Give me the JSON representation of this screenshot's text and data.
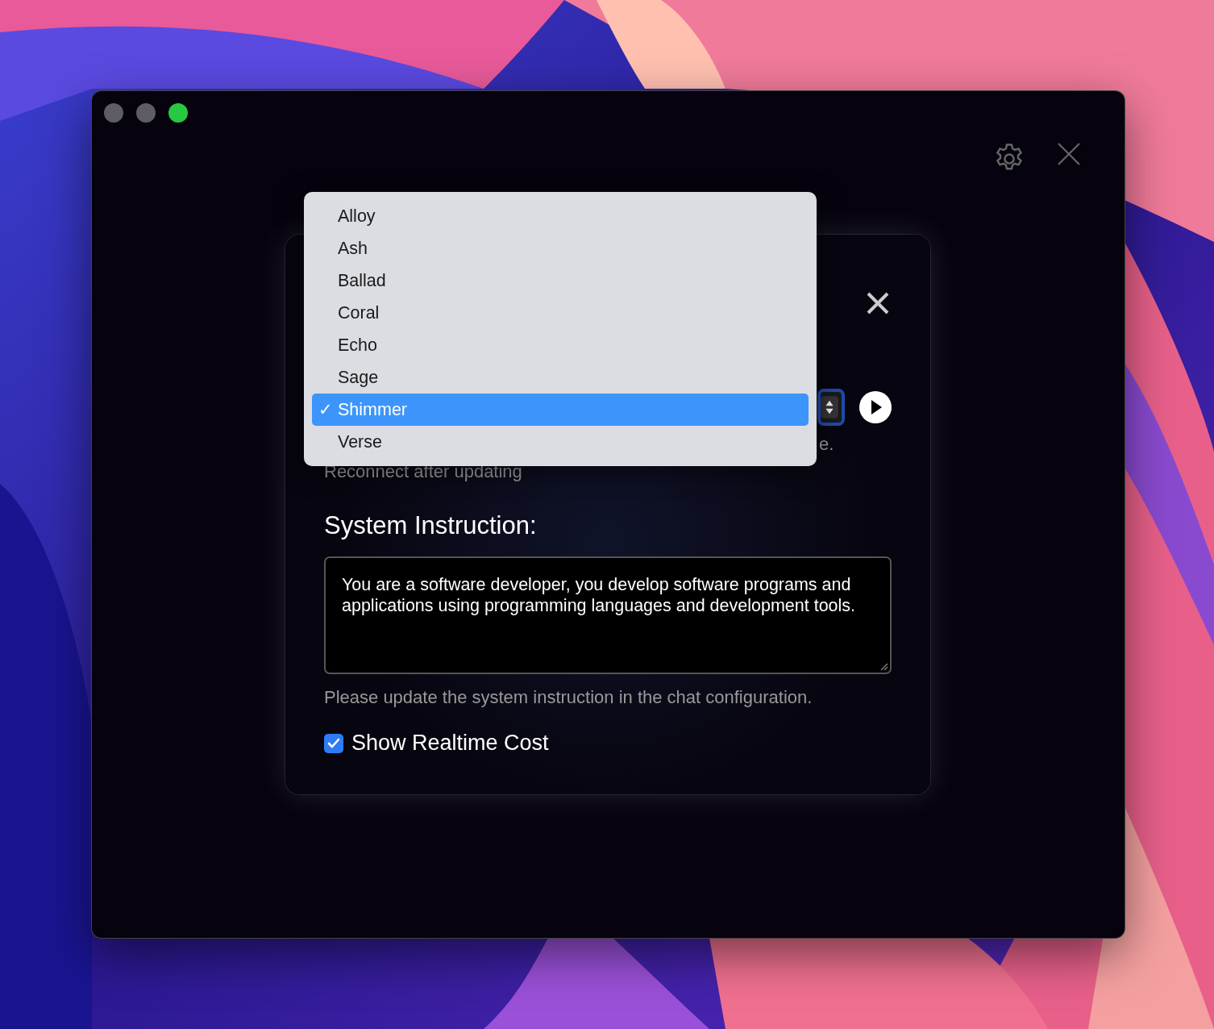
{
  "voice_menu": {
    "items": [
      {
        "label": "Alloy",
        "selected": false
      },
      {
        "label": "Ash",
        "selected": false
      },
      {
        "label": "Ballad",
        "selected": false
      },
      {
        "label": "Coral",
        "selected": false
      },
      {
        "label": "Echo",
        "selected": false
      },
      {
        "label": "Sage",
        "selected": false
      },
      {
        "label": "Shimmer",
        "selected": true
      },
      {
        "label": "Verse",
        "selected": false
      }
    ]
  },
  "check_mark": "✓",
  "settings_panel": {
    "voice_hint_tail": "e.",
    "reconnect_note": "Reconnect after updating",
    "instruction_heading": "System Instruction:",
    "instruction_value": "You are a software developer, you develop software programs and applications using programming languages and development tools.",
    "instruction_hint": "Please update the system instruction in the chat configuration.",
    "show_cost": {
      "label": "Show Realtime Cost",
      "checked": true
    }
  }
}
